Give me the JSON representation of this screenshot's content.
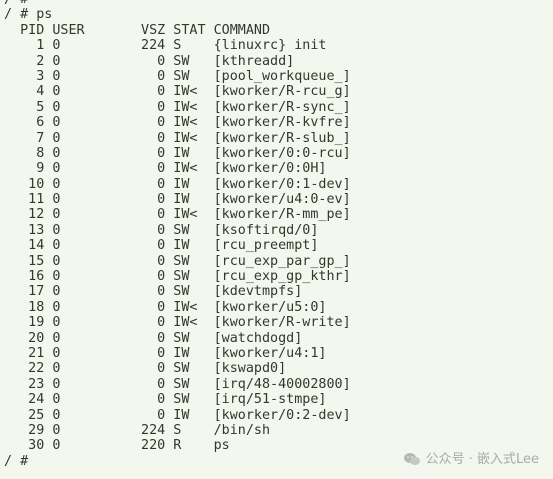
{
  "terminal": {
    "lines": [
      "/ #",
      "/ # ps",
      "  PID USER       VSZ STAT COMMAND",
      "    1 0          224 S    {linuxrc} init",
      "    2 0            0 SW   [kthreadd]",
      "    3 0            0 SW   [pool_workqueue_]",
      "    4 0            0 IW<  [kworker/R-rcu_g]",
      "    5 0            0 IW<  [kworker/R-sync_]",
      "    6 0            0 IW<  [kworker/R-kvfre]",
      "    7 0            0 IW<  [kworker/R-slub_]",
      "    8 0            0 IW   [kworker/0:0-rcu]",
      "    9 0            0 IW<  [kworker/0:0H]",
      "   10 0            0 IW   [kworker/0:1-dev]",
      "   11 0            0 IW   [kworker/u4:0-ev]",
      "   12 0            0 IW<  [kworker/R-mm_pe]",
      "   13 0            0 SW   [ksoftirqd/0]",
      "   14 0            0 IW   [rcu_preempt]",
      "   15 0            0 SW   [rcu_exp_par_gp_]",
      "   16 0            0 SW   [rcu_exp_gp_kthr]",
      "   17 0            0 SW   [kdevtmpfs]",
      "   18 0            0 IW<  [kworker/u5:0]",
      "   19 0            0 IW<  [kworker/R-write]",
      "   20 0            0 SW   [watchdogd]",
      "   21 0            0 IW   [kworker/u4:1]",
      "   22 0            0 SW   [kswapd0]",
      "   23 0            0 SW   [irq/48-40002800]",
      "   24 0            0 SW   [irq/51-stmpe]",
      "   25 0            0 IW   [kworker/0:2-dev]",
      "   29 0          224 S    /bin/sh",
      "   30 0          220 R    ps",
      "/ #"
    ]
  },
  "watermark": {
    "text": "公众号 · 嵌入式Lee",
    "icon": "wechat-icon"
  },
  "colors": {
    "background": "#f3f7ee",
    "text": "#2f3a2d",
    "watermark": "#a7aca6"
  }
}
